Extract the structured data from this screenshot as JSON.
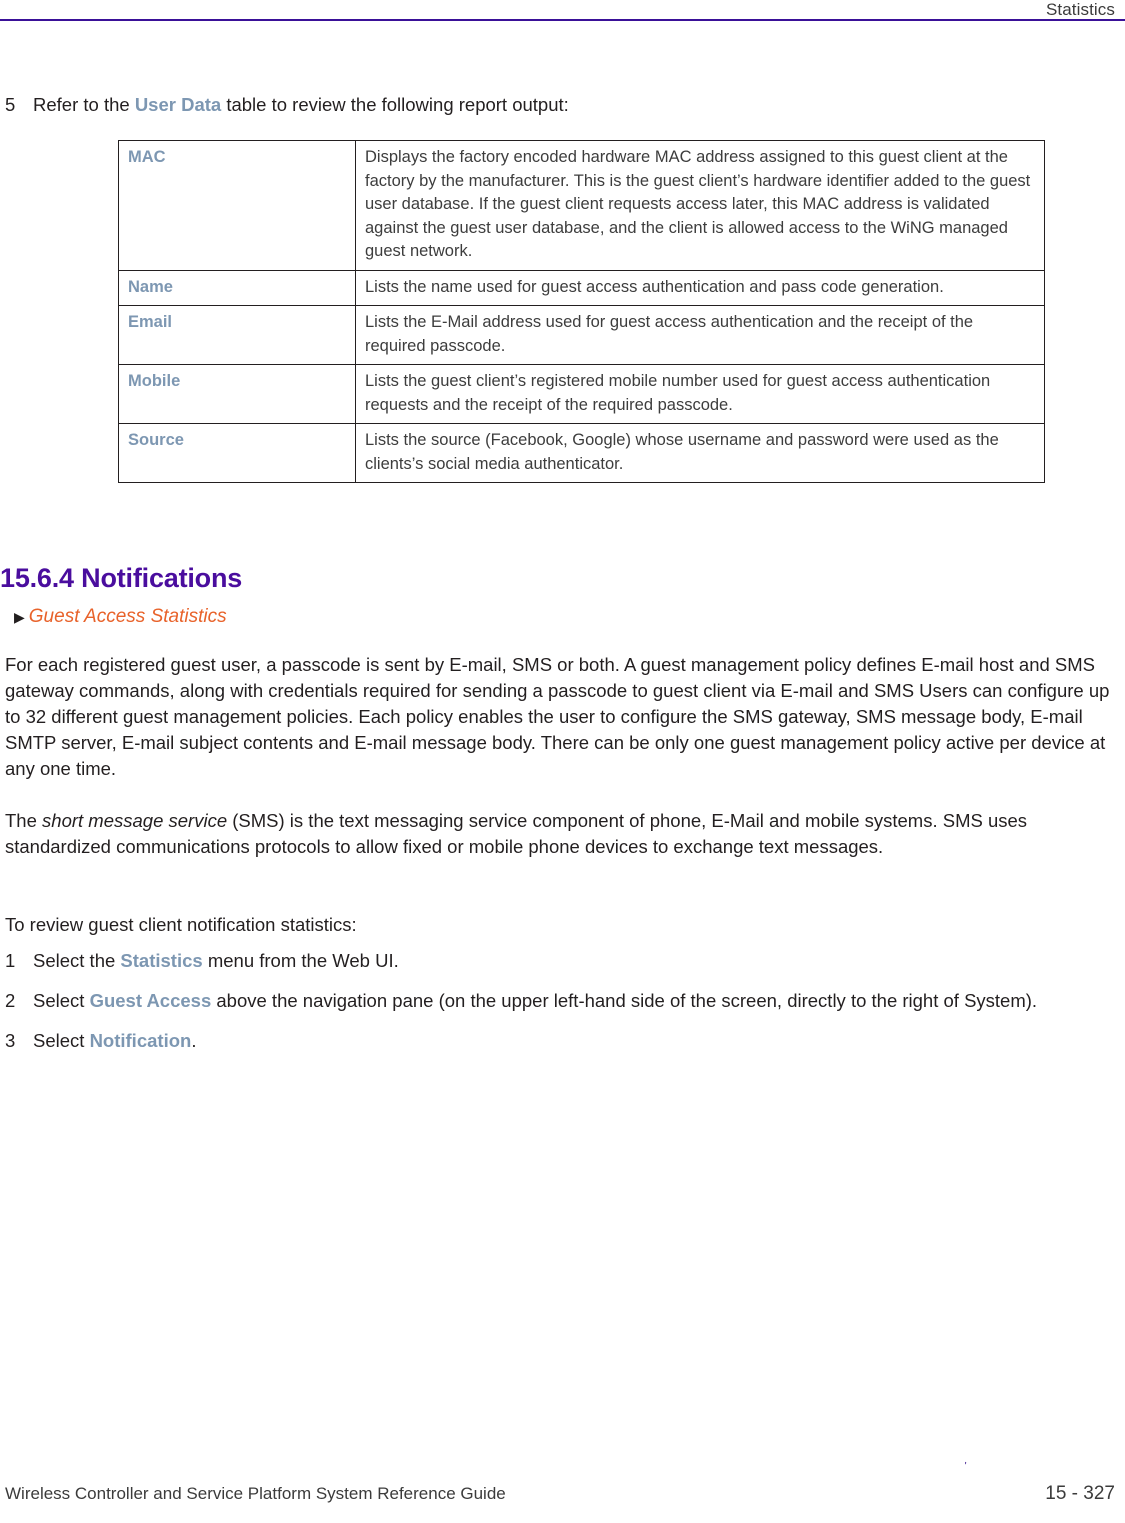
{
  "header": {
    "title": "Statistics",
    "rule_color": "#3a1198"
  },
  "colors": {
    "heading_purple": "#4a0d9e",
    "term_blue": "#7d97b2",
    "crossref_orange": "#e8622a",
    "body_text": "#231f20"
  },
  "step5": {
    "number": "5",
    "text_before": "Refer to the ",
    "term": "User Data",
    "text_after": " table to review the following report output:"
  },
  "user_data_table": {
    "rows": [
      {
        "term": "MAC",
        "description": "Displays the factory encoded hardware MAC address assigned to this guest client at the factory by the manufacturer. This is the guest client’s hardware identifier added to the guest user database. If the guest client requests access later, this MAC address is validated against the guest user database, and the client is allowed access to the WiNG managed guest network."
      },
      {
        "term": "Name",
        "description": "Lists the name used for guest access authentication and pass code generation."
      },
      {
        "term": "Email",
        "description": "Lists the E-Mail address used for guest access authentication and the receipt of the required passcode."
      },
      {
        "term": "Mobile",
        "description": "Lists the guest client’s registered mobile number used for guest access authentication requests and the receipt of the required passcode."
      },
      {
        "term": "Source",
        "description": "Lists the source (Facebook, Google) whose username and password were used as the clients’s social media authenticator."
      }
    ]
  },
  "section": {
    "heading": "15.6.4 Notifications",
    "crossref_arrow": "▶",
    "crossref": "Guest Access Statistics"
  },
  "paragraphs": {
    "p1": "For each registered guest user, a passcode is sent by E-mail, SMS or both. A guest management policy defines E-mail host and SMS gateway commands, along with credentials required for sending a passcode to guest client via E-mail and SMS Users can configure up to 32 different guest management policies. Each policy enables the user to configure the SMS gateway, SMS message body, E-mail SMTP server, E-mail subject contents and E-mail message body. There can be only one guest management policy active per device at any one time.",
    "p2_before": "The ",
    "p2_italic": "short message service",
    "p2_after": " (SMS) is the text messaging service component of phone, E-Mail and mobile systems. SMS uses standardized communications protocols to allow fixed or mobile phone devices to exchange text messages.",
    "p3": "To review guest client notification statistics:"
  },
  "steps": [
    {
      "number": "1",
      "text_before": "Select the ",
      "term": "Statistics",
      "text_after": " menu from the Web UI."
    },
    {
      "number": "2",
      "text_before": "Select ",
      "term": "Guest Access",
      "text_after": " above the navigation pane (on the upper left-hand side of the screen, directly to the right of System)."
    },
    {
      "number": "3",
      "text_before": "Select ",
      "term": "Notification",
      "text_after": "."
    }
  ],
  "footer": {
    "title": "Wireless Controller and Service Platform System Reference Guide",
    "page": "15 - 327"
  }
}
